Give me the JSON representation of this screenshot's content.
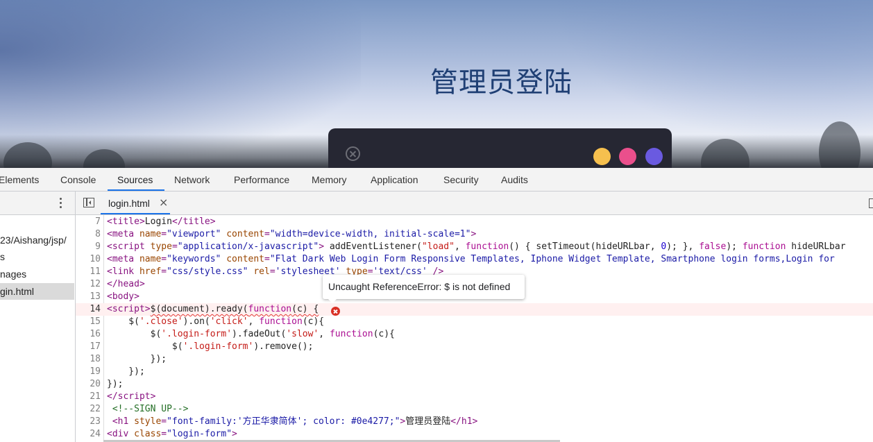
{
  "page": {
    "heading": "管理员登陆",
    "colors": {
      "dot1": "#f6c04e",
      "dot2": "#ea4f8c",
      "dot3": "#6a5ae0",
      "form_bg": "#262733"
    }
  },
  "devtools": {
    "tabs": [
      "Elements",
      "Console",
      "Sources",
      "Network",
      "Performance",
      "Memory",
      "Application",
      "Security",
      "Audits"
    ],
    "active_tab": "Sources",
    "navigator": {
      "items": [
        "23/Aishang/jsp/",
        "s",
        "nages",
        "gin.html"
      ],
      "selected": "gin.html"
    },
    "editor": {
      "file_tab": "login.html",
      "close_glyph": "×",
      "error_tooltip": "Uncaught ReferenceError: $ is not defined",
      "line_numbers": [
        "7",
        "8",
        "9",
        "10",
        "11",
        "12",
        "13",
        "14",
        "15",
        "16",
        "17",
        "18",
        "19",
        "20",
        "21",
        "22",
        "23",
        "24"
      ]
    }
  }
}
